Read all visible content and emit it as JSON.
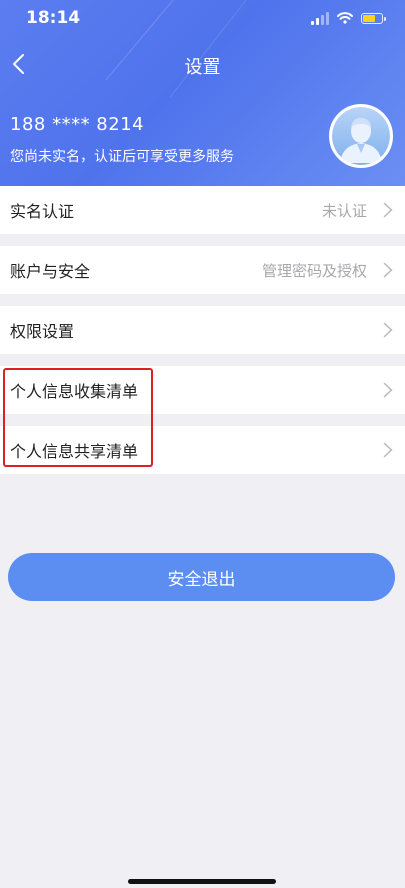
{
  "status_bar": {
    "time": "18:14"
  },
  "nav": {
    "title": "设置"
  },
  "profile": {
    "phone": "188 **** 8214",
    "hint": "您尚未实名，认证后可享受更多服务"
  },
  "menu": [
    {
      "label": "实名认证",
      "value": "未认证"
    },
    {
      "label": "账户与安全",
      "value": "管理密码及授权"
    },
    {
      "label": "权限设置",
      "value": ""
    },
    {
      "label": "个人信息收集清单",
      "value": ""
    },
    {
      "label": "个人信息共享清单",
      "value": ""
    }
  ],
  "logout": {
    "label": "安全退出"
  },
  "colors": {
    "header_blue": "#4f73ec",
    "button_blue": "#5b8ef0",
    "highlight_red": "#e02020",
    "background": "#efeff4"
  }
}
